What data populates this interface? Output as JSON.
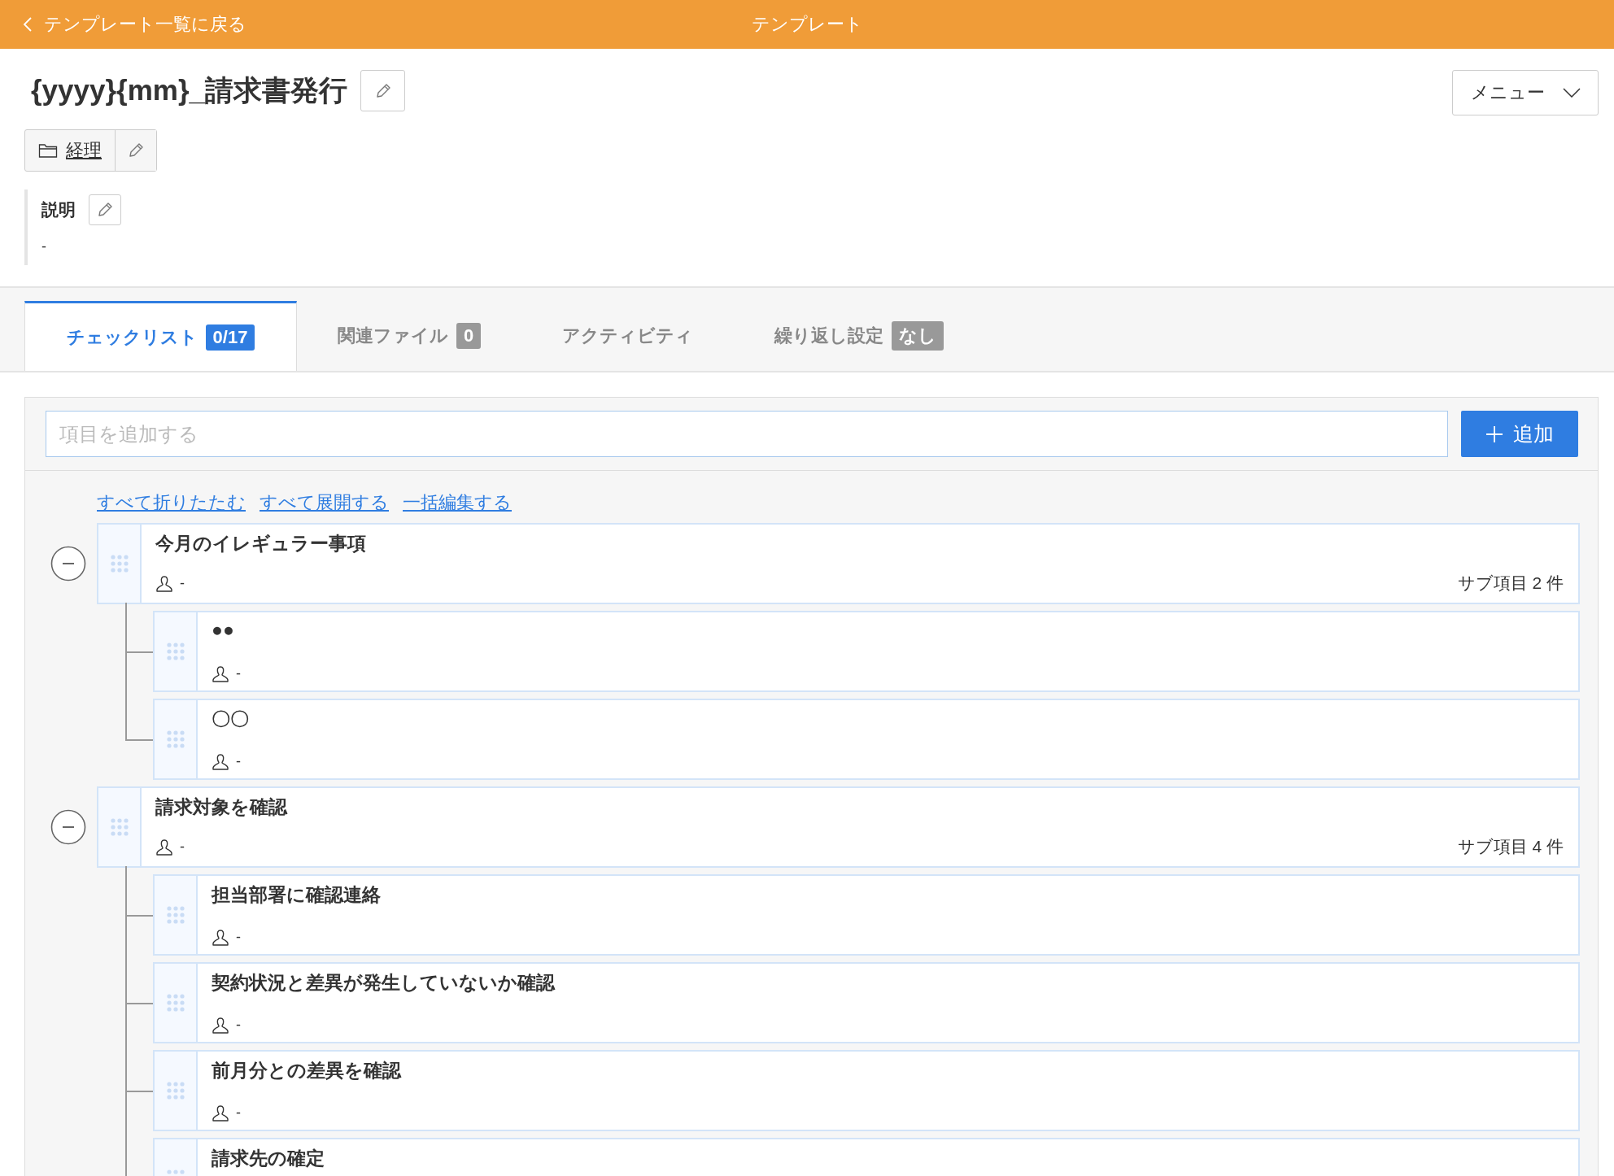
{
  "header": {
    "back_link": "テンプレート一覧に戻る",
    "title": "テンプレート"
  },
  "template": {
    "name": "{yyyy}{mm}_請求書発行",
    "folder": "経理",
    "menu_button": "メニュー"
  },
  "description": {
    "label": "説明",
    "text": "-"
  },
  "tabs": [
    {
      "label": "チェックリスト",
      "badge": "0/17",
      "selected": true
    },
    {
      "label": "関連ファイル",
      "badge": "0",
      "selected": false
    },
    {
      "label": "アクティビティ",
      "selected": false
    },
    {
      "label": "繰り返し設定",
      "badge": "なし",
      "selected": false
    }
  ],
  "add_item": {
    "placeholder": "項目を追加する",
    "button": "追加"
  },
  "actions": [
    "すべて折りたたむ",
    "すべて展開する",
    "一括編集する"
  ],
  "checklist": [
    {
      "title": "今月のイレギュラー事項",
      "assignee": "-",
      "subitem_count": "サブ項目 2 件",
      "expanded": true,
      "children": [
        {
          "title": "●●",
          "assignee": "-"
        },
        {
          "title": "〇〇",
          "assignee": "-"
        }
      ]
    },
    {
      "title": "請求対象を確認",
      "assignee": "-",
      "subitem_count": "サブ項目 4 件",
      "expanded": true,
      "children": [
        {
          "title": "担当部署に確認連絡",
          "assignee": "-"
        },
        {
          "title": "契約状況と差異が発生していないか確認",
          "assignee": "-"
        },
        {
          "title": "前月分との差異を確認",
          "assignee": "-"
        },
        {
          "title": "請求先の確定"
        }
      ]
    }
  ]
}
